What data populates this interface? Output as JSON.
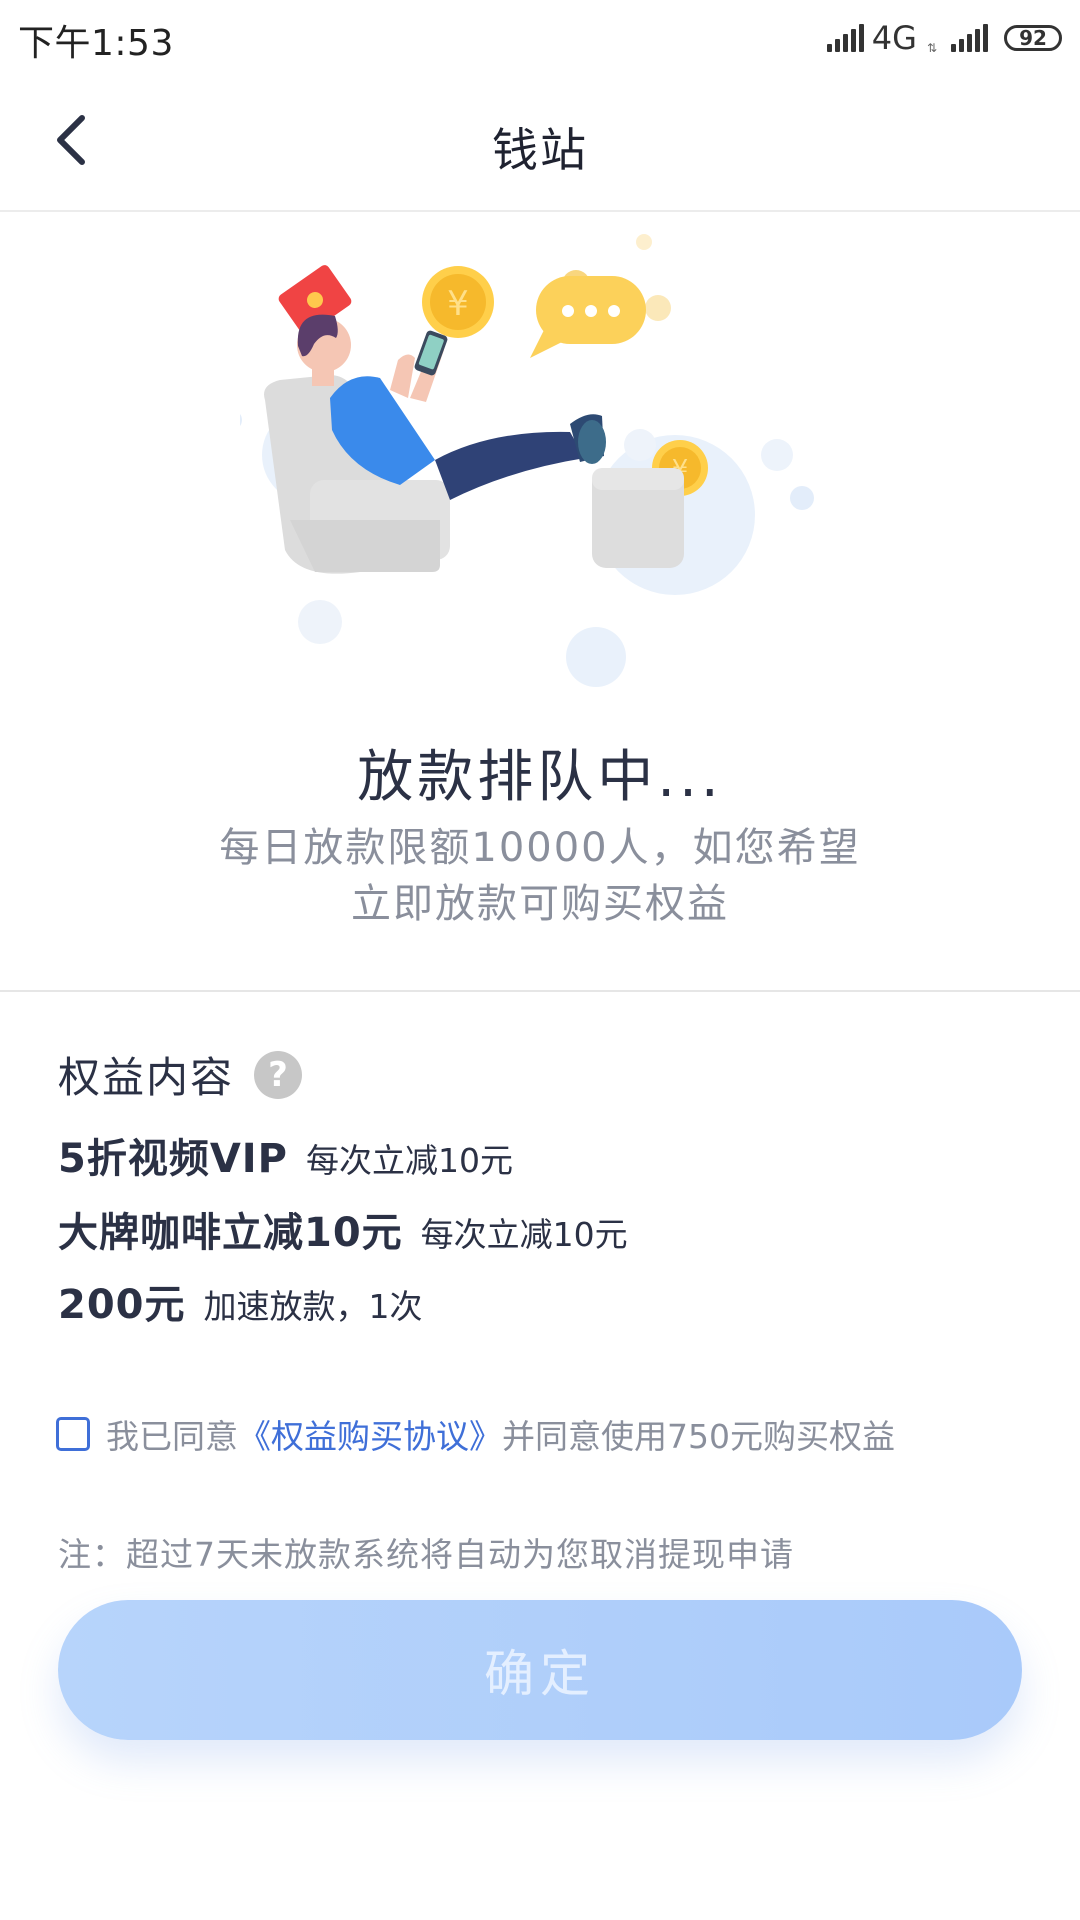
{
  "status_bar": {
    "time": "下午1:53",
    "network": "4G",
    "battery": "92"
  },
  "header": {
    "title": "钱站",
    "back_icon": "chevron-left-icon"
  },
  "illustration": {
    "description_icon": "queue-illustration"
  },
  "queue": {
    "title": "放款排队中...",
    "desc_line1": "每日放款限额10000人，如您希望",
    "desc_line2": "立即放款可购买权益"
  },
  "benefits": {
    "title": "权益内容",
    "items": [
      {
        "main": "5折视频VIP",
        "sub": "每次立减10元"
      },
      {
        "main": "大牌咖啡立减10元",
        "sub": "每次立减10元"
      },
      {
        "main": "200元",
        "sub": "加速放款，1次"
      }
    ]
  },
  "agreement": {
    "prefix": "我已同意",
    "link": "《权益购买协议》",
    "suffix": "并同意使用750元购买权益",
    "checked": false
  },
  "note": "注：超过7天未放款系统将自动为您取消提现申请",
  "confirm_button": "确定",
  "colors": {
    "accent_blue": "#3f6fd8",
    "button_bg": "#b7d4fb",
    "text_dark": "#2b3145",
    "text_gray": "#8a8f9c"
  }
}
